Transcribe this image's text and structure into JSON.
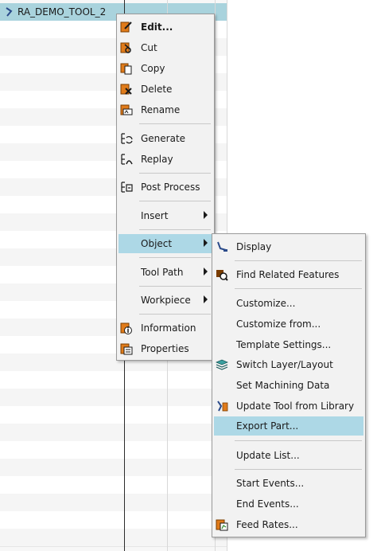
{
  "tree": {
    "selected_item": "RA_DEMO_TOOL_2"
  },
  "context_menu": {
    "items": [
      {
        "label": "Edit...",
        "icon": "edit-icon"
      },
      {
        "label": "Cut",
        "icon": "cut-icon"
      },
      {
        "label": "Copy",
        "icon": "copy-icon"
      },
      {
        "label": "Delete",
        "icon": "delete-icon"
      },
      {
        "label": "Rename",
        "icon": "rename-icon"
      },
      {
        "label": "Generate",
        "icon": "generate-icon"
      },
      {
        "label": "Replay",
        "icon": "replay-icon"
      },
      {
        "label": "Post Process",
        "icon": "post-process-icon"
      },
      {
        "label": "Insert"
      },
      {
        "label": "Object"
      },
      {
        "label": "Tool Path"
      },
      {
        "label": "Workpiece"
      },
      {
        "label": "Information",
        "icon": "information-icon"
      },
      {
        "label": "Properties",
        "icon": "properties-icon"
      }
    ]
  },
  "object_submenu": {
    "items": [
      {
        "label": "Display",
        "icon": "display-icon"
      },
      {
        "label": "Find Related Features",
        "icon": "find-related-features-icon"
      },
      {
        "label": "Customize..."
      },
      {
        "label": "Customize from..."
      },
      {
        "label": "Template Settings..."
      },
      {
        "label": "Switch Layer/Layout",
        "icon": "switch-layer-icon"
      },
      {
        "label": "Set Machining Data"
      },
      {
        "label": "Update Tool from Library",
        "icon": "update-tool-icon"
      },
      {
        "label": "Export Part..."
      },
      {
        "label": "Update List..."
      },
      {
        "label": "Start Events..."
      },
      {
        "label": "End Events..."
      },
      {
        "label": "Feed Rates...",
        "icon": "feed-rates-icon"
      }
    ]
  },
  "colors": {
    "selection": "#a9d3dd",
    "menu_highlight": "#add8e6",
    "menu_bg": "#f2f2f2",
    "icon_orange": "#e07b1a"
  }
}
